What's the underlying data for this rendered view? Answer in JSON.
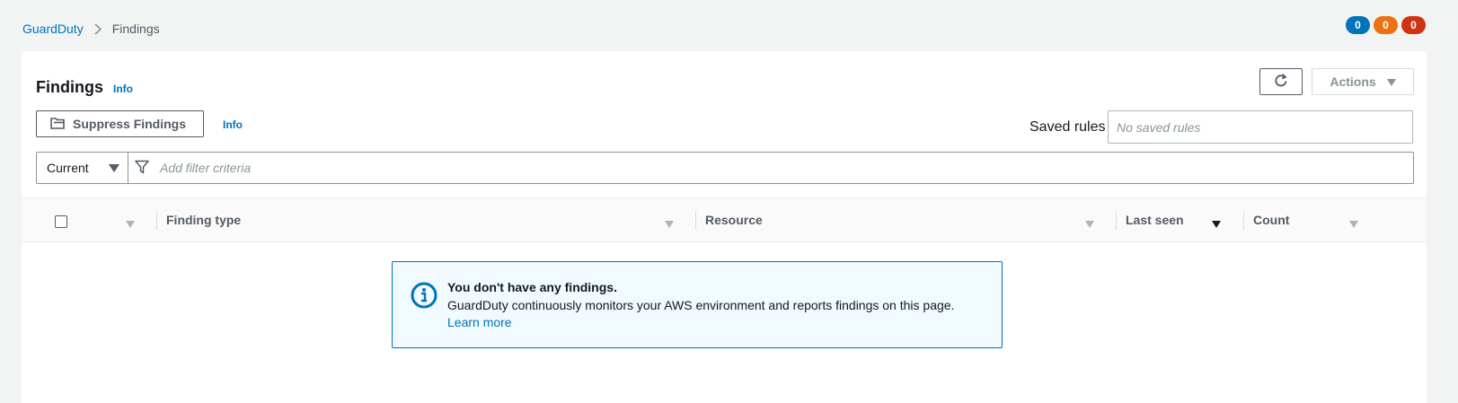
{
  "breadcrumb": {
    "root": "GuardDuty",
    "current": "Findings"
  },
  "badges": [
    {
      "value": "0",
      "color": "#0073bb"
    },
    {
      "value": "0",
      "color": "#ec7211"
    },
    {
      "value": "0",
      "color": "#d13212"
    }
  ],
  "panel": {
    "title": "Findings",
    "info": "Info",
    "actions_label": "Actions",
    "suppress_label": "Suppress Findings",
    "suppress_info": "Info",
    "saved_rules_label": "Saved rules",
    "saved_rules_placeholder": "No saved rules"
  },
  "filter": {
    "selected": "Current",
    "placeholder": "Add filter criteria"
  },
  "table": {
    "columns": [
      "Finding type",
      "Resource",
      "Last seen",
      "Count"
    ]
  },
  "empty_state": {
    "title": "You don't have any findings.",
    "body": "GuardDuty continuously monitors your AWS environment and reports findings on this page.",
    "link": "Learn more"
  }
}
